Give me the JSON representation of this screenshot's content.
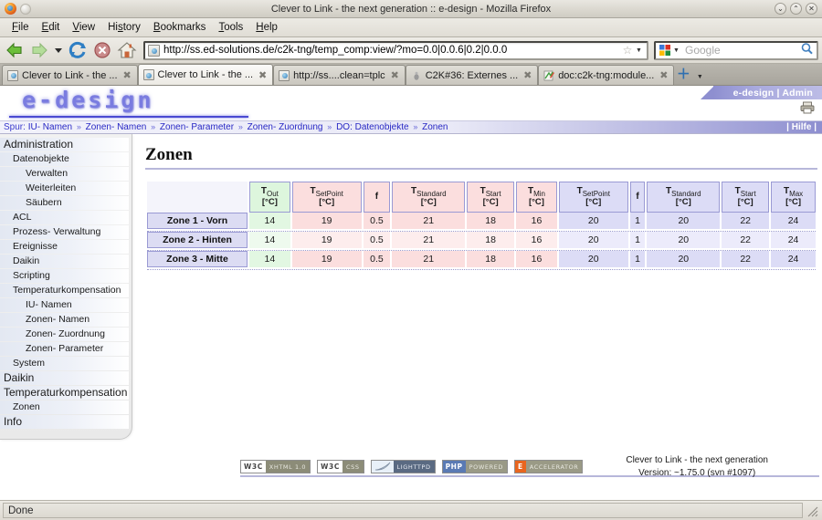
{
  "browser": {
    "window_title": "Clever to Link - the next generation :: e-design - Mozilla Firefox",
    "window_buttons": {
      "minimize": "⌄",
      "maximize": "⌃",
      "close": "✕"
    },
    "menu": [
      {
        "label": "File",
        "accel": "F"
      },
      {
        "label": "Edit",
        "accel": "E"
      },
      {
        "label": "View",
        "accel": "V"
      },
      {
        "label": "History",
        "accel": "s"
      },
      {
        "label": "Bookmarks",
        "accel": "B"
      },
      {
        "label": "Tools",
        "accel": "T"
      },
      {
        "label": "Help",
        "accel": "H"
      }
    ],
    "toolbar_icons": [
      "back-arrow-icon",
      "forward-arrow-icon",
      "history-dropdown-icon",
      "reload-icon",
      "stop-icon",
      "home-icon"
    ],
    "url": "http://ss.ed-solutions.de/c2k-tng/temp_comp:view/?mo=0.0|0.0.6|0.2|0.0.0",
    "bookmark_star": "☆",
    "url_dropdown": "▼",
    "search_placeholder": "Google",
    "search_engine_icon": "google-icon",
    "search_submit_icon": "magnifier-icon",
    "tabs": [
      {
        "label": "Clever to Link - the ...",
        "icon": "page-favicon",
        "active": false,
        "close": "✖"
      },
      {
        "label": "Clever to Link - the ...",
        "icon": "page-favicon",
        "active": true,
        "close": "✖"
      },
      {
        "label": "http://ss....clean=tplc",
        "icon": "page-favicon",
        "active": false,
        "close": "✖"
      },
      {
        "label": "C2K#36: Externes ...",
        "icon": "bug-favicon",
        "active": false,
        "close": "✖"
      },
      {
        "label": "doc:c2k-tng:module...",
        "icon": "wiki-favicon",
        "active": false,
        "close": "✖"
      }
    ],
    "new_tab_label": "＋",
    "tab_list_arrow": "▼",
    "status": "Done"
  },
  "page": {
    "logo": "e-design",
    "admin_tab": "e-design | Admin",
    "print_icon": "printer-icon",
    "help_link": "| Hilfe |",
    "breadcrumb_prefix": "Spur:",
    "breadcrumb": [
      "IU- Namen",
      "Zonen- Namen",
      "Zonen- Parameter",
      "Zonen- Zuordnung",
      "DO: Datenobjekte",
      "Zonen"
    ],
    "breadcrumb_separator": "»",
    "title": "Zonen"
  },
  "sidebar": {
    "items": [
      {
        "label": "Administration",
        "level": 0
      },
      {
        "label": "Datenobjekte",
        "level": 1
      },
      {
        "label": "Verwalten",
        "level": 2
      },
      {
        "label": "Weiterleiten",
        "level": 2
      },
      {
        "label": "Säubern",
        "level": 2
      },
      {
        "label": "ACL",
        "level": 1
      },
      {
        "label": "Prozess- Verwaltung",
        "level": 1
      },
      {
        "label": "Ereignisse",
        "level": 1
      },
      {
        "label": "Daikin",
        "level": 1
      },
      {
        "label": "Scripting",
        "level": 1
      },
      {
        "label": "Temperaturkompensation",
        "level": 1
      },
      {
        "label": "IU- Namen",
        "level": 2
      },
      {
        "label": "Zonen- Namen",
        "level": 2
      },
      {
        "label": "Zonen- Zuordnung",
        "level": 2
      },
      {
        "label": "Zonen- Parameter",
        "level": 2
      },
      {
        "label": "System",
        "level": 1
      },
      {
        "label": "Daikin",
        "level": 0
      },
      {
        "label": "Temperaturkompensation",
        "level": 0
      },
      {
        "label": "Zonen",
        "level": 1
      },
      {
        "label": "Info",
        "level": 0
      }
    ]
  },
  "table": {
    "columns": [
      {
        "symbol": "T",
        "sub": "Out",
        "unit": "[°C]",
        "tone": "green"
      },
      {
        "symbol": "T",
        "sub": "SetPoint",
        "unit": "[°C]",
        "tone": "pink"
      },
      {
        "symbol": "f",
        "sub": "",
        "unit": "",
        "tone": "pink"
      },
      {
        "symbol": "T",
        "sub": "Standard",
        "unit": "[°C]",
        "tone": "pink"
      },
      {
        "symbol": "T",
        "sub": "Start",
        "unit": "[°C]",
        "tone": "pink"
      },
      {
        "symbol": "T",
        "sub": "Min",
        "unit": "[°C]",
        "tone": "pink"
      },
      {
        "symbol": "T",
        "sub": "SetPoint",
        "unit": "[°C]",
        "tone": "blue"
      },
      {
        "symbol": "f",
        "sub": "",
        "unit": "",
        "tone": "blue"
      },
      {
        "symbol": "T",
        "sub": "Standard",
        "unit": "[°C]",
        "tone": "blue"
      },
      {
        "symbol": "T",
        "sub": "Start",
        "unit": "[°C]",
        "tone": "blue"
      },
      {
        "symbol": "T",
        "sub": "Max",
        "unit": "[°C]",
        "tone": "blue"
      }
    ],
    "rows": [
      {
        "label": "Zone 1 - Vorn",
        "values": [
          "14",
          "19",
          "0.5",
          "21",
          "18",
          "16",
          "20",
          "1",
          "20",
          "22",
          "24"
        ]
      },
      {
        "label": "Zone 2 - Hinten",
        "values": [
          "14",
          "19",
          "0.5",
          "21",
          "18",
          "16",
          "20",
          "1",
          "20",
          "22",
          "24"
        ]
      },
      {
        "label": "Zone 3 - Mitte",
        "values": [
          "14",
          "19",
          "0.5",
          "21",
          "18",
          "16",
          "20",
          "1",
          "20",
          "22",
          "24"
        ]
      }
    ]
  },
  "footer": {
    "badges": [
      {
        "left": "W3C",
        "right": "XHTML 1.0",
        "style": "w3c"
      },
      {
        "left": "W3C",
        "right": "CSS",
        "style": "w3c"
      },
      {
        "left": "",
        "right": "LIGHTTPD",
        "style": "lighttpd"
      },
      {
        "left": "PHP",
        "right": "POWERED",
        "style": "php"
      },
      {
        "left": "E",
        "right": "ACCELERATOR",
        "style": "eacc"
      }
    ],
    "product": "Clever to Link - the next generation",
    "version": "Version: ~1.75.0 (svn #1097)"
  },
  "colors": {
    "accent": "#8e8fd0",
    "link": "#3a3acd",
    "cool_tone": "#dcdcf6",
    "warm_tone": "#fbdede",
    "out_tone": "#ddf6dd"
  }
}
